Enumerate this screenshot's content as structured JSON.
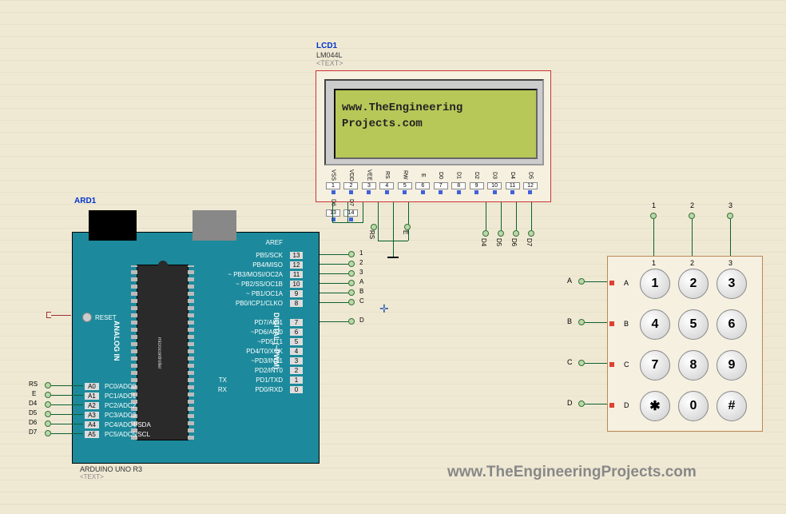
{
  "arduino": {
    "ref": "ARD1",
    "model": "ARDUINO UNO R3",
    "sub": "<TEXT>",
    "reset": "RESET",
    "aref": "AREF",
    "analog_label": "ANALOG IN",
    "digital_label": "DIGITAL (~PWM)",
    "chip_brand": "microcontroller",
    "pins_right": [
      {
        "num": "13",
        "lbl": "PB5/SCK"
      },
      {
        "num": "12",
        "lbl": "PB4/MISO"
      },
      {
        "num": "11",
        "lbl": "~ PB3/MOSI/OC2A"
      },
      {
        "num": "10",
        "lbl": "~ PB2/SS/OC1B"
      },
      {
        "num": "9",
        "lbl": "~ PB1/OC1A"
      },
      {
        "num": "8",
        "lbl": "PB0/ICP1/CLKO"
      },
      {
        "num": "7",
        "lbl": "PD7/AIN1"
      },
      {
        "num": "6",
        "lbl": "~PD6/AIN0"
      },
      {
        "num": "5",
        "lbl": "~PD5/T1"
      },
      {
        "num": "4",
        "lbl": "PD4/T0/XCK"
      },
      {
        "num": "3",
        "lbl": "~PD3/INT1"
      },
      {
        "num": "2",
        "lbl": "PD2/INT0"
      },
      {
        "num": "1",
        "lbl": "PD1/TXD",
        "pre": "TX"
      },
      {
        "num": "0",
        "lbl": "PD0/RXD",
        "pre": "RX"
      }
    ],
    "pins_left": [
      {
        "num": "A0",
        "lbl": "PC0/ADC0"
      },
      {
        "num": "A1",
        "lbl": "PC1/ADC1"
      },
      {
        "num": "A2",
        "lbl": "PC2/ADC2"
      },
      {
        "num": "A3",
        "lbl": "PC3/ADC3"
      },
      {
        "num": "A4",
        "lbl": "PC4/ADC4/SDA"
      },
      {
        "num": "A5",
        "lbl": "PC5/ADC5/SCL"
      }
    ],
    "ext_left": [
      "RS",
      "E",
      "D4",
      "D5",
      "D6",
      "D7"
    ],
    "ext_right": [
      "1",
      "2",
      "3",
      "A",
      "B",
      "C",
      "",
      "D"
    ]
  },
  "lcd": {
    "ref": "LCD1",
    "model": "LM044L",
    "sub": "<TEXT>",
    "line1": "www.TheEngineering",
    "line2": "Projects.com",
    "pins": [
      "VSS",
      "VDD",
      "VEE",
      "RS",
      "RW",
      "E",
      "D0",
      "D1",
      "D2",
      "D3",
      "D4",
      "D5",
      "D6",
      "D7"
    ],
    "pin_nums": [
      "1",
      "2",
      "3",
      "4",
      "5",
      "6",
      "7",
      "8",
      "9",
      "10",
      "11",
      "12",
      "13",
      "14"
    ],
    "nets": [
      "RS",
      "",
      "E",
      "",
      "",
      "",
      "D4",
      "D5",
      "D6",
      "D7"
    ]
  },
  "keypad": {
    "rows": [
      "A",
      "B",
      "C",
      "D"
    ],
    "cols": [
      "1",
      "2",
      "3"
    ],
    "keys": [
      [
        "1",
        "2",
        "3"
      ],
      [
        "4",
        "5",
        "6"
      ],
      [
        "7",
        "8",
        "9"
      ],
      [
        "✱",
        "0",
        "#"
      ]
    ]
  },
  "watermark": "www.TheEngineeringProjects.com"
}
